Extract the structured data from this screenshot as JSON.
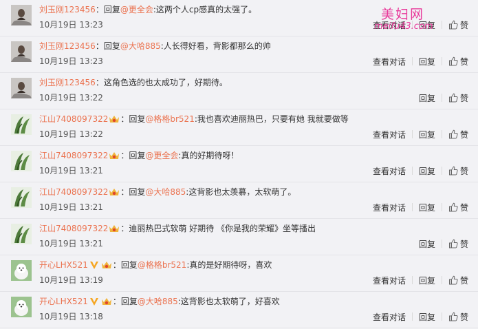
{
  "watermark": {
    "title": "美妇网",
    "url": "meifu43.com"
  },
  "labels": {
    "view_dialog": "查看对话",
    "reply": "回复",
    "like": "赞"
  },
  "comments": [
    {
      "user": "刘玉刚123456",
      "badges": [],
      "reply_prefix": "：回复",
      "at": "@更全会",
      "text": ":这两个人cp感真的太强了。",
      "time": "10月19日 13:23",
      "has_view": true
    },
    {
      "user": "刘玉刚123456",
      "badges": [],
      "reply_prefix": "：回复",
      "at": "@大哈885",
      "text": ":人长得好看，背影都那么的帅",
      "time": "10月19日 13:23",
      "has_view": true
    },
    {
      "user": "刘玉刚123456",
      "badges": [],
      "reply_prefix": "",
      "at": "",
      "text": "：这角色选的也太成功了，好期待。",
      "time": "10月19日 13:22",
      "has_view": false
    },
    {
      "user": "江山7408097322",
      "badges": [
        "vip"
      ],
      "reply_prefix": "：回复",
      "at": "@格格br521",
      "text": ":我也喜欢迪丽热巴，只要有她 我就要做等",
      "time": "10月19日 13:22",
      "has_view": true
    },
    {
      "user": "江山7408097322",
      "badges": [
        "vip"
      ],
      "reply_prefix": "：回复",
      "at": "@更全会",
      "text": ":真的好期待呀！",
      "time": "10月19日 13:21",
      "has_view": true
    },
    {
      "user": "江山7408097322",
      "badges": [
        "vip"
      ],
      "reply_prefix": "：回复",
      "at": "@大哈885",
      "text": ":这背影也太羡慕，太软萌了。",
      "time": "10月19日 13:21",
      "has_view": true
    },
    {
      "user": "江山7408097322",
      "badges": [
        "vip"
      ],
      "reply_prefix": "",
      "at": "",
      "text": "：迪丽热巴式软萌 好期待 《你是我的荣耀》坐等播出",
      "time": "10月19日 13:21",
      "has_view": false
    },
    {
      "user": "开心LHX521",
      "badges": [
        "v",
        "vip"
      ],
      "reply_prefix": "：回复",
      "at": "@格格br521",
      "text": ":真的是好期待呀，喜欢",
      "time": "10月19日 13:19",
      "has_view": true
    },
    {
      "user": "开心LHX521",
      "badges": [
        "v",
        "vip"
      ],
      "reply_prefix": "：回复",
      "at": "@大哈885",
      "text": ":这背影也太软萌了，好喜欢",
      "time": "10月19日 13:18",
      "has_view": true
    }
  ]
}
